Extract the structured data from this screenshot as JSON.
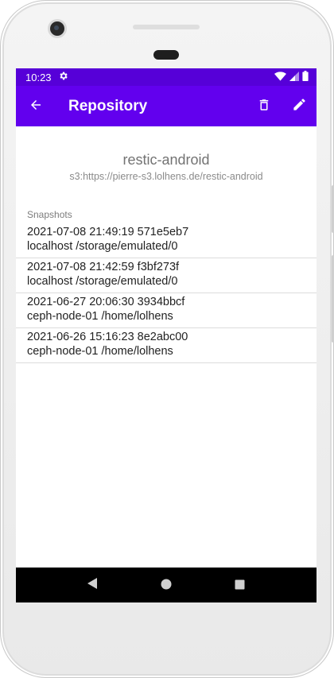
{
  "status": {
    "time": "10:23"
  },
  "appbar": {
    "title": "Repository"
  },
  "repo": {
    "name": "restic-android",
    "url": "s3:https://pierre-s3.lolhens.de/restic-android"
  },
  "snapshots": {
    "label": "Snapshots",
    "items": [
      {
        "line1": "2021-07-08 21:49:19 571e5eb7",
        "line2": "localhost /storage/emulated/0"
      },
      {
        "line1": "2021-07-08 21:42:59 f3bf273f",
        "line2": "localhost /storage/emulated/0"
      },
      {
        "line1": "2021-06-27 20:06:30 3934bbcf",
        "line2": "ceph-node-01 /home/lolhens"
      },
      {
        "line1": "2021-06-26 15:16:23 8e2abc00",
        "line2": "ceph-node-01 /home/lolhens"
      }
    ]
  },
  "colors": {
    "statusbar": "#5600d8",
    "appbar": "#6200ee"
  },
  "icons": {
    "status": [
      "settings-gear-icon",
      "wifi-icon",
      "signal-icon",
      "battery-icon"
    ],
    "appbar": [
      "arrow-back-icon",
      "delete-icon",
      "edit-icon"
    ],
    "navbar": [
      "back-triangle-icon",
      "home-circle-icon",
      "recents-square-icon"
    ]
  }
}
